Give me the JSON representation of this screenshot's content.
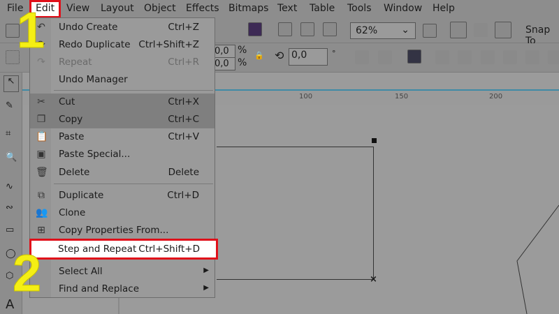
{
  "menubar": [
    "File",
    "Edit",
    "View",
    "Layout",
    "Object",
    "Effects",
    "Bitmaps",
    "Text",
    "Table",
    "Tools",
    "Window",
    "Help"
  ],
  "toolbar": {
    "zoom": "62%",
    "snap": "Snap To",
    "pct1": "0,0",
    "pct2": "0,0",
    "pct_unit": "%",
    "angle": "0,0",
    "degree": "°"
  },
  "ruler": [
    "100",
    "150",
    "200"
  ],
  "edit_menu": [
    {
      "label": "Undo Create",
      "shortcut": "Ctrl+Z",
      "icon": "undo-icon"
    },
    {
      "label": "Redo Duplicate",
      "shortcut": "Ctrl+Shift+Z",
      "icon": "redo-icon"
    },
    {
      "label": "Repeat",
      "shortcut": "Ctrl+R",
      "icon": "repeat-icon",
      "disabled": true
    },
    {
      "label": "Undo Manager",
      "shortcut": ""
    },
    {
      "label": "Cut",
      "shortcut": "Ctrl+X",
      "icon": "scissors-icon"
    },
    {
      "label": "Copy",
      "shortcut": "Ctrl+C",
      "icon": "copy-icon"
    },
    {
      "label": "Paste",
      "shortcut": "Ctrl+V",
      "icon": "paste-icon"
    },
    {
      "label": "Paste Special...",
      "shortcut": "",
      "icon": "paste-special-icon"
    },
    {
      "label": "Delete",
      "shortcut": "Delete",
      "icon": "trash-icon"
    },
    {
      "label": "Duplicate",
      "shortcut": "Ctrl+D",
      "icon": "duplicate-icon"
    },
    {
      "label": "Clone",
      "shortcut": "",
      "icon": "clone-icon"
    },
    {
      "label": "Copy Properties From...",
      "shortcut": "",
      "icon": "copy-properties-icon"
    },
    {
      "label": "Step and Repeat",
      "shortcut": "Ctrl+Shift+D"
    },
    {
      "label": "Select All",
      "shortcut": ""
    },
    {
      "label": "Find and Replace",
      "shortcut": ""
    }
  ],
  "annotations": {
    "step1": "1",
    "step2": "2"
  },
  "colors": {
    "highlight": "#e0101a",
    "annotation": "#f5ef14"
  }
}
